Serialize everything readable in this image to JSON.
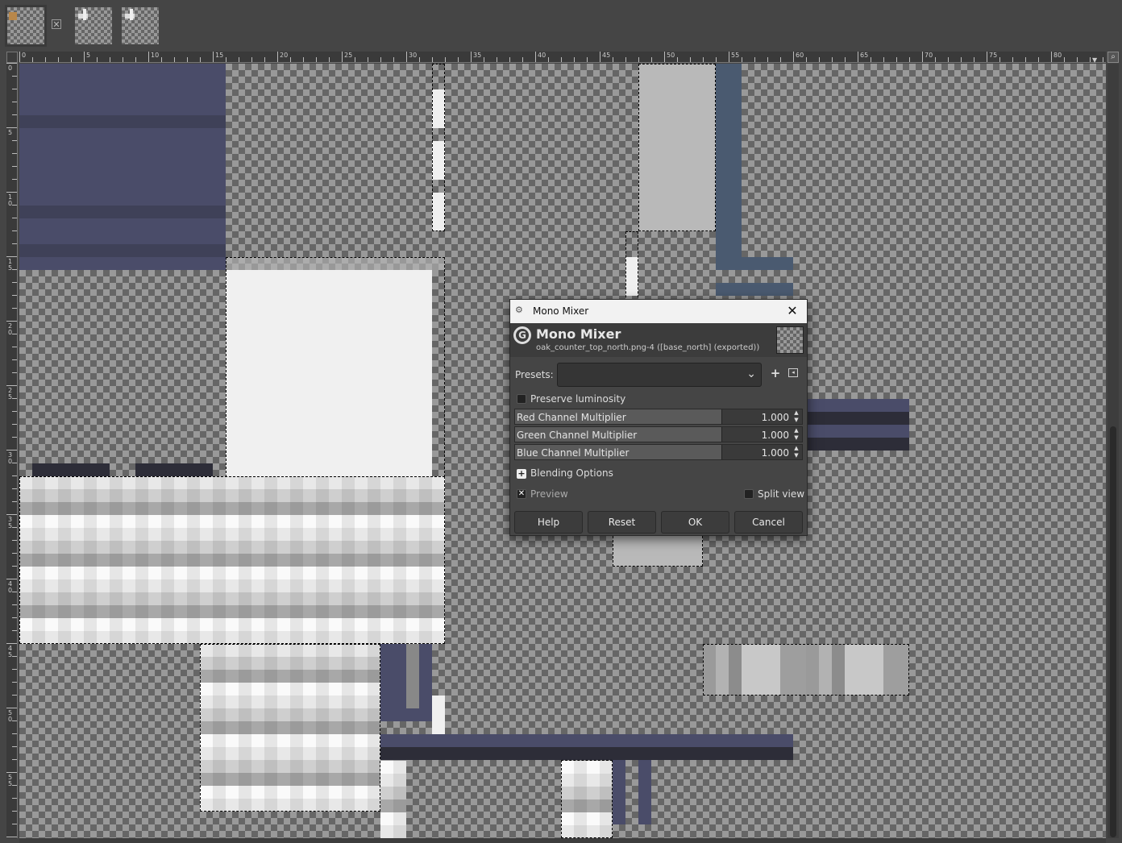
{
  "tabs": [
    {
      "name": "image-tab-1",
      "active": true
    },
    {
      "name": "image-tab-2",
      "active": false
    },
    {
      "name": "image-tab-3",
      "active": false
    }
  ],
  "ruler": {
    "h_labels": [
      "0",
      "5",
      "10",
      "15",
      "20",
      "25",
      "30",
      "35",
      "40",
      "45",
      "50",
      "55",
      "60",
      "65",
      "70",
      "75",
      "80"
    ],
    "v_labels": [
      "0",
      "5",
      "10",
      "15",
      "20",
      "25",
      "30",
      "35",
      "40",
      "45",
      "50",
      "55"
    ]
  },
  "dialog": {
    "window_title": "Mono Mixer",
    "heading": "Mono Mixer",
    "subheading": "oak_counter_top_north.png-4 ([base_north] (exported))",
    "presets_label": "Presets:",
    "presets_value": "",
    "preserve_luminosity": {
      "label": "Preserve luminosity",
      "checked": false
    },
    "red": {
      "label": "Red Channel Multiplier",
      "value": "1.000",
      "fraction": 1.0
    },
    "green": {
      "label": "Green Channel Multiplier",
      "value": "1.000",
      "fraction": 1.0
    },
    "blue": {
      "label": "Blue Channel Multiplier",
      "value": "1.000",
      "fraction": 1.0
    },
    "blending_options": "Blending Options",
    "preview": {
      "label": "Preview",
      "checked": true
    },
    "split_view": {
      "label": "Split view",
      "checked": false
    },
    "buttons": {
      "help": "Help",
      "reset": "Reset",
      "ok": "OK",
      "cancel": "Cancel"
    }
  },
  "icons": {
    "close": "close-icon",
    "chevron": "chevron-down-icon",
    "add": "plus-icon",
    "menu": "preset-menu-icon",
    "zoom": "zoom-icon"
  }
}
